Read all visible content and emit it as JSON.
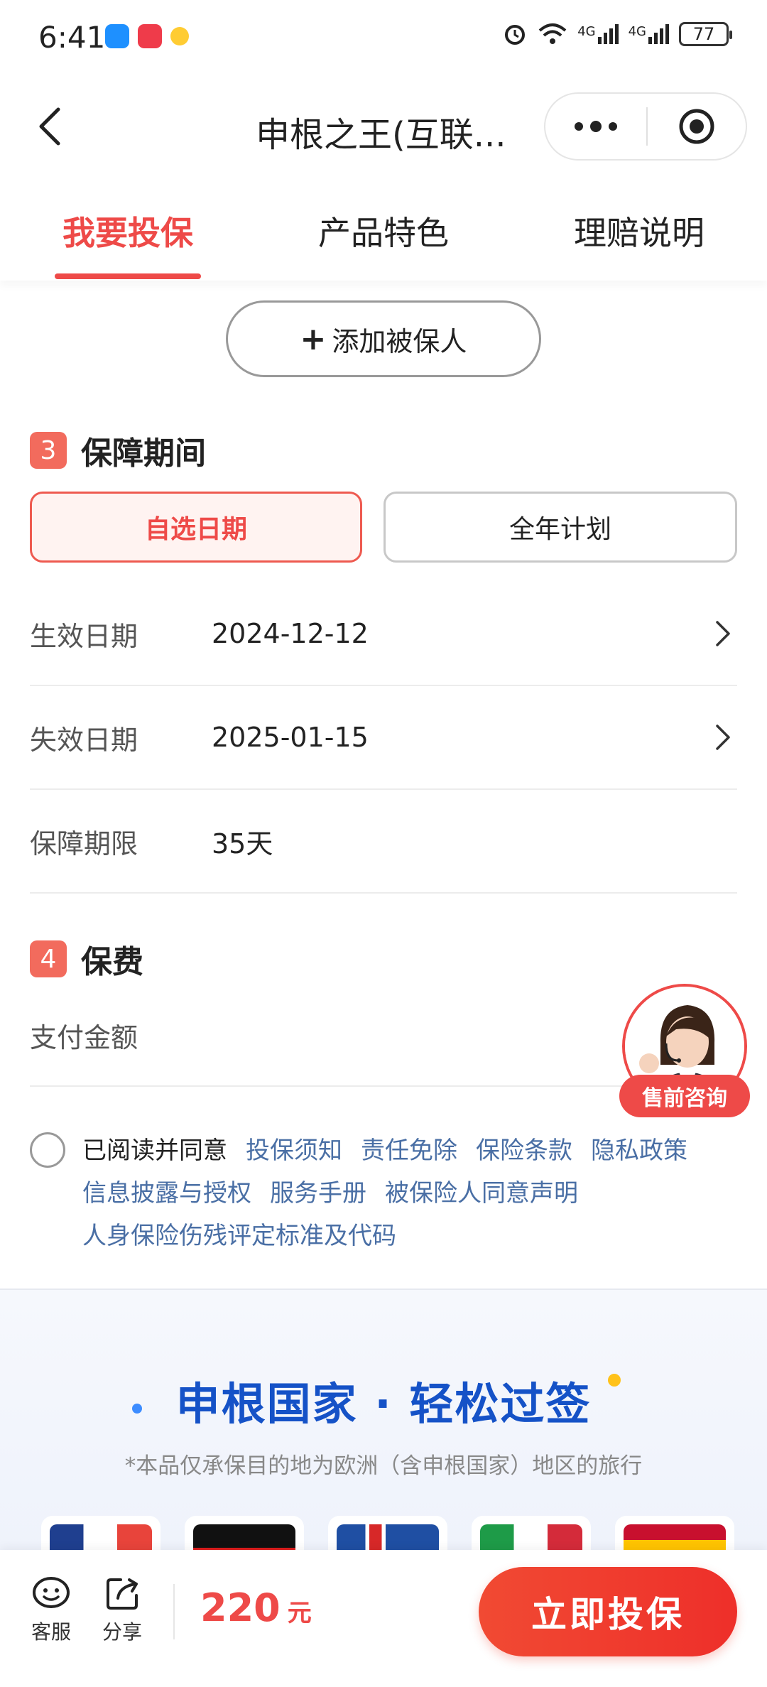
{
  "status_bar": {
    "time": "6:41",
    "network_1": "4G",
    "network_2": "4G",
    "battery": "77"
  },
  "nav": {
    "title": "申根之王(互联..."
  },
  "tabs": [
    {
      "label": "我要投保",
      "active": true
    },
    {
      "label": "产品特色",
      "active": false
    },
    {
      "label": "理赔说明",
      "active": false
    }
  ],
  "add_insured": {
    "plus": "+",
    "label": "添加被保人"
  },
  "section_period": {
    "number": "3",
    "title": "保障期间",
    "options": [
      "自选日期",
      "全年计划"
    ]
  },
  "dates": {
    "start_label": "生效日期",
    "start_value": "2024-12-12",
    "end_label": "失效日期",
    "end_value": "2025-01-15",
    "duration_label": "保障期限",
    "duration_value": "35天"
  },
  "section_fee": {
    "number": "4",
    "title": "保费",
    "pay_label": "支付金额"
  },
  "consult": {
    "label": "售前咨询"
  },
  "agreement": {
    "lead": "已阅读并同意",
    "links": [
      "投保须知",
      "责任免除",
      "保险条款",
      "隐私政策",
      "信息披露与授权",
      "服务手册",
      "被保险人同意声明",
      "人身保险伤残评定标准及代码"
    ]
  },
  "banner": {
    "title": "申根国家 · 轻松过签",
    "subtitle": "*本品仅承保目的地为欧洲（含申根国家）地区的旅行"
  },
  "bottom_bar": {
    "service_label": "客服",
    "share_label": "分享",
    "price": "220",
    "price_unit": "元",
    "buy_label": "立即投保"
  },
  "colors": {
    "accent": "#ee4a48",
    "link": "#4a6fa5",
    "banner_title": "#1552c7"
  }
}
